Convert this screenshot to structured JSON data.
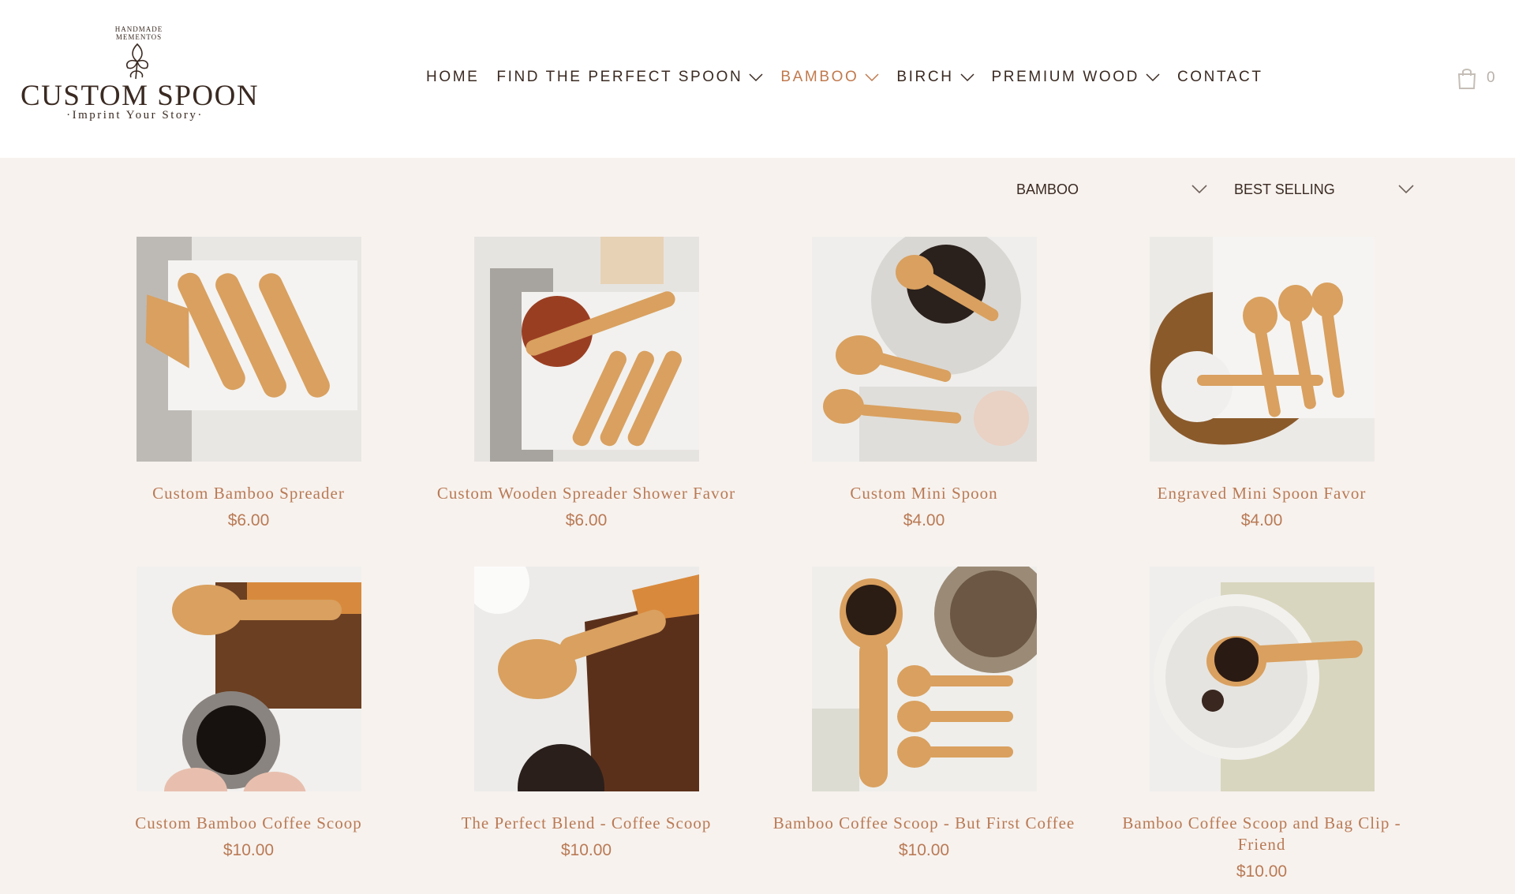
{
  "brand": {
    "tagline_top": "HANDMADE MEMENTOS",
    "name": "CUSTOM SPOON",
    "subtitle": "·Imprint Your Story·"
  },
  "nav": {
    "items": [
      {
        "label": "HOME",
        "has_dropdown": false,
        "active": false
      },
      {
        "label": "FIND THE PERFECT SPOON",
        "has_dropdown": true,
        "active": false
      },
      {
        "label": "BAMBOO",
        "has_dropdown": true,
        "active": true
      },
      {
        "label": "BIRCH",
        "has_dropdown": true,
        "active": false
      },
      {
        "label": "PREMIUM WOOD",
        "has_dropdown": true,
        "active": false
      },
      {
        "label": "CONTACT",
        "has_dropdown": false,
        "active": false
      }
    ]
  },
  "cart": {
    "icon": "shopping-bag-icon",
    "count": "0"
  },
  "filters": {
    "collection": "BAMBOO",
    "sort": "BEST SELLING"
  },
  "products": [
    {
      "title": "Custom Bamboo Spreader",
      "price": "$6.00"
    },
    {
      "title": "Custom Wooden Spreader Shower Favor",
      "price": "$6.00"
    },
    {
      "title": "Custom Mini Spoon",
      "price": "$4.00"
    },
    {
      "title": "Engraved Mini Spoon Favor",
      "price": "$4.00"
    },
    {
      "title": "Custom Bamboo Coffee Scoop",
      "price": "$10.00"
    },
    {
      "title": "The Perfect Blend - Coffee Scoop",
      "price": "$10.00"
    },
    {
      "title": "Bamboo Coffee Scoop - But First Coffee",
      "price": "$10.00"
    },
    {
      "title": "Bamboo Coffee Scoop and Bag Clip - Friend",
      "price": "$10.00"
    }
  ],
  "colors": {
    "accent": "#c07a4e",
    "product_text": "#b97a55",
    "text": "#3a2a22",
    "page_bg": "#f7f2ee",
    "header_bg": "#ffffff"
  }
}
